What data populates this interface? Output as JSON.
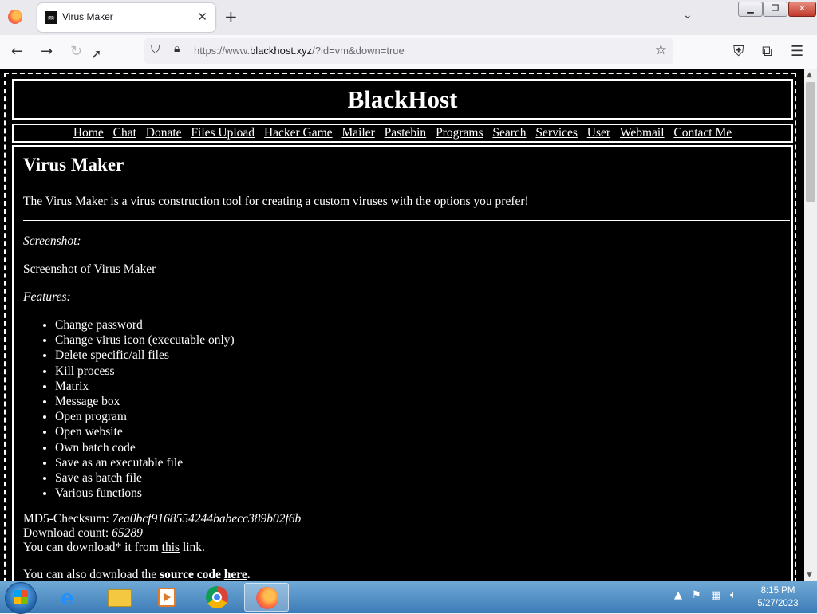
{
  "browser": {
    "tab_title": "Virus Maker",
    "tab_favicon": "☠",
    "url_prefix": "https://www.",
    "url_domain": "blackhost.xyz",
    "url_suffix": "/?id=vm&down=true",
    "icons": {
      "back": "back-arrow-icon",
      "forward": "forward-arrow-icon",
      "reload": "reload-icon",
      "shield": "shield-icon",
      "lock": "lock-icon",
      "star": "bookmark-star-icon",
      "pocket": "pocket-icon",
      "extensions": "extensions-icon",
      "menu": "hamburger-menu-icon"
    }
  },
  "site": {
    "brand": "BlackHost",
    "menu": [
      "Home",
      "Chat",
      "Donate",
      "Files Upload",
      "Hacker Game",
      "Mailer",
      "Pastebin",
      "Programs",
      "Search",
      "Services",
      "User",
      "Webmail",
      "Contact Me"
    ]
  },
  "page": {
    "title": "Virus Maker",
    "description": "The Virus Maker is a virus construction tool for creating a custom viruses with the options you prefer!",
    "screenshot_label": "Screenshot:",
    "screenshot_text": "Screenshot of Virus Maker",
    "features_label": "Features:",
    "features": [
      "Change password",
      "Change virus icon (executable only)",
      "Delete specific/all files",
      "Kill process",
      "Matrix",
      "Message box",
      "Open program",
      "Open website",
      "Own batch code",
      "Save as an executable file",
      "Save as batch file",
      "Various functions"
    ],
    "md5_label": "MD5-Checksum:",
    "md5_value": "7ea0bcf9168554244babecc389b02f6b",
    "count_label": "Download count:",
    "count_value": "65289",
    "download_pre": "You can download* it from",
    "download_link": "this",
    "download_post": "link.",
    "source_pre": "You can also download the",
    "source_bold": "source code",
    "source_link": "here",
    "source_post": "."
  },
  "taskbar": {
    "time": "8:15 PM",
    "date": "5/27/2023"
  }
}
